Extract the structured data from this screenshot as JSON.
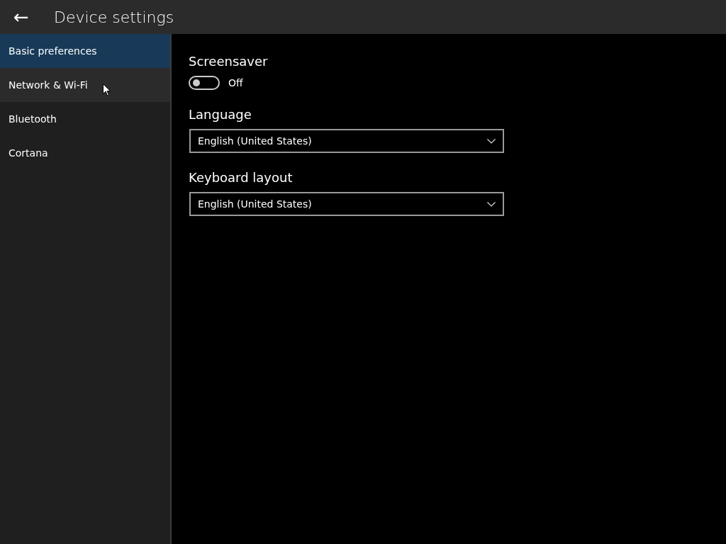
{
  "header": {
    "back": "←",
    "title": "Device settings"
  },
  "sidebar": {
    "items": [
      {
        "label": "Basic preferences",
        "selected": true,
        "hovered": false
      },
      {
        "label": "Network & Wi-Fi",
        "selected": false,
        "hovered": true
      },
      {
        "label": "Bluetooth",
        "selected": false,
        "hovered": false
      },
      {
        "label": "Cortana",
        "selected": false,
        "hovered": false
      }
    ]
  },
  "settings": [
    {
      "kind": "toggle",
      "label": "Screensaver",
      "on": false,
      "state_text": "Off"
    },
    {
      "kind": "dropdown",
      "label": "Language",
      "value": "English (United States)"
    },
    {
      "kind": "dropdown",
      "label": "Keyboard layout",
      "value": "English (United States)"
    }
  ]
}
